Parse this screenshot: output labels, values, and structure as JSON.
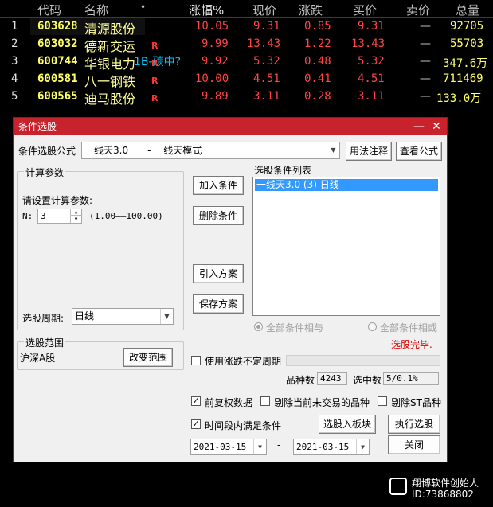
{
  "table": {
    "headers": [
      "代码",
      "名称",
      "•",
      "涨幅%",
      "现价",
      "涨跌",
      "买价",
      "卖价",
      "总量"
    ],
    "rows": [
      {
        "idx": "1",
        "code": "603628",
        "name": "清源股份",
        "flag": "",
        "pct": "10.05",
        "price": "9.31",
        "chg": "0.85",
        "bid": "9.31",
        "ask": "—",
        "vol": "92705"
      },
      {
        "idx": "2",
        "code": "603032",
        "name": "德新交运",
        "flag": "R",
        "pct": "9.99",
        "price": "13.43",
        "chg": "1.22",
        "bid": "13.43",
        "ask": "—",
        "vol": "55703"
      },
      {
        "idx": "3",
        "code": "600744",
        "name": "华银电力",
        "flag": "R",
        "pct": "9.92",
        "price": "5.32",
        "chg": "0.48",
        "bid": "5.32",
        "ask": "—",
        "vol": "347.6万"
      },
      {
        "idx": "4",
        "code": "600581",
        "name": "八一钢铁",
        "flag": "R",
        "pct": "10.00",
        "price": "4.51",
        "chg": "0.41",
        "bid": "4.51",
        "ask": "—",
        "vol": "711469"
      },
      {
        "idx": "5",
        "code": "600565",
        "name": "迪马股份",
        "flag": "R",
        "pct": "9.89",
        "price": "3.11",
        "chg": "0.28",
        "bid": "3.11",
        "ask": "—",
        "vol": "133.0万"
      }
    ],
    "row3_note": "1B-碳中?"
  },
  "dialog": {
    "title": "条件选股",
    "minimize": "—",
    "close": "✕",
    "formula_label": "条件选股公式",
    "formula_value": "一线天3.0　　- 一线天模式",
    "usage_button": "用法注释",
    "view_formula_button": "查看公式",
    "params_group": "计算参数",
    "params_prompt": "请设置计算参数:",
    "n_label": "N:",
    "n_value": "3",
    "n_range": "(1.00——100.00)",
    "period_label": "选股周期:",
    "period_value": "日线",
    "add_condition": "加入条件",
    "delete_condition": "删除条件",
    "import_plan": "引入方案",
    "save_plan": "保存方案",
    "list_label": "选股条件列表",
    "list_items": [
      "一线天3.0 (3) 日线"
    ],
    "radio_and": "全部条件相与",
    "radio_or": "全部条件相或",
    "status": "选股完毕.",
    "scope_group": "选股范围",
    "scope_value": "沪深A股",
    "change_scope": "改变范围",
    "uncertain_period_label": "使用涨跌不定周期",
    "variety_count_label": "品种数",
    "variety_count": "4243",
    "selected_count_label": "选中数",
    "selected_count": "5/0.1%",
    "pre_adjust_label": "前复权数据",
    "exclude_untraded_label": "剔除当前未交易的品种",
    "exclude_st_label": "剔除ST品种",
    "interval_label": "时间段内满足条件",
    "to_block_button": "选股入板块",
    "run_button": "执行选股",
    "date_from": "2021-03-15",
    "date_sep": "-",
    "date_to": "2021-03-15",
    "close_button": "关闭",
    "checks": {
      "uncertain_period": false,
      "pre_adjust": true,
      "exclude_untraded": false,
      "exclude_st": false,
      "interval": true
    }
  },
  "watermark": {
    "line1": "翔博软件创始人",
    "line2": "ID:73868802"
  },
  "colors": {
    "title_bar": "#c8232c",
    "price_red": "#ff4444",
    "code_yellow": "#ffff66",
    "selection_blue": "#3399ff"
  }
}
